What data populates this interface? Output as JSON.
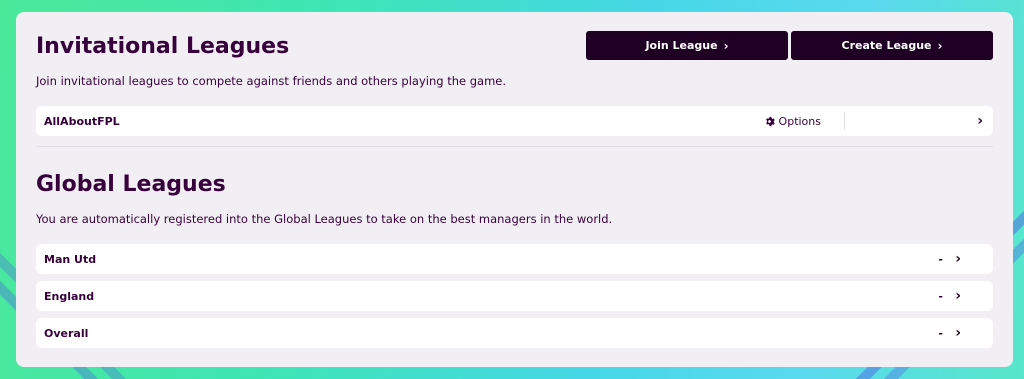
{
  "invitational": {
    "title": "Invitational Leagues",
    "description": "Join invitational leagues to compete against friends and others playing the game.",
    "join_label": "Join League",
    "create_label": "Create League",
    "leagues": [
      {
        "name": "AllAboutFPL",
        "options_label": "Options"
      }
    ]
  },
  "global": {
    "title": "Global Leagues",
    "description": "You are automatically registered into the Global Leagues to take on the best managers in the world.",
    "leagues": [
      {
        "name": "Man Utd",
        "rank": "-"
      },
      {
        "name": "England",
        "rank": "-"
      },
      {
        "name": "Overall",
        "rank": "-"
      }
    ]
  },
  "icons": {
    "chevron": "chevron-right-icon",
    "gear": "gear-icon"
  },
  "colors": {
    "primary": "#37003c",
    "button_bg": "#1f0024",
    "panel_bg": "#f2eff4"
  }
}
